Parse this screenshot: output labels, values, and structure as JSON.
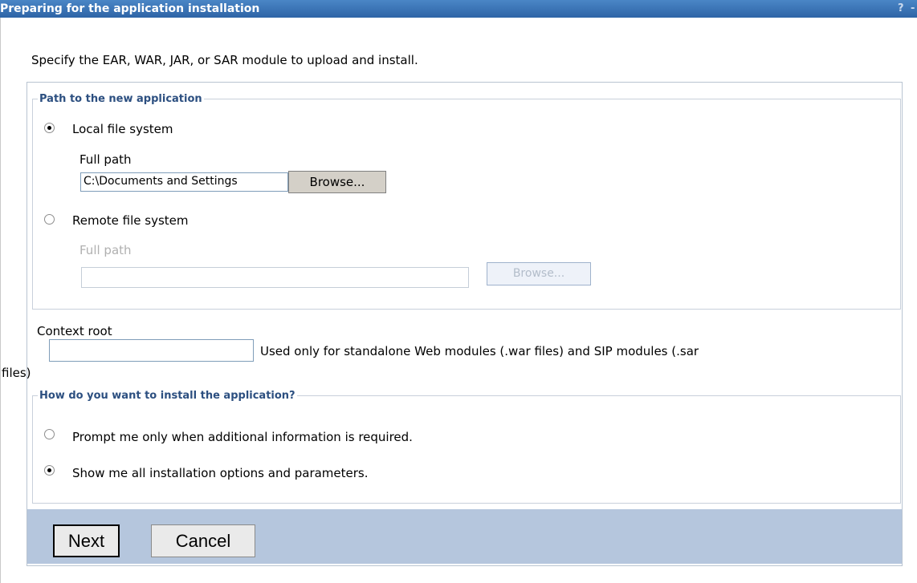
{
  "header": {
    "title": "Preparing for the application installation",
    "help": "?",
    "minimize": "-"
  },
  "instruction": "Specify the EAR, WAR, JAR, or SAR module to upload and install.",
  "path_group": {
    "legend": "Path to the new application",
    "local": {
      "label": "Local file system",
      "selected": true,
      "full_path_label": "Full path",
      "value": "C:\\Documents and Settings",
      "browse": "Browse..."
    },
    "remote": {
      "label": "Remote file system",
      "selected": false,
      "full_path_label": "Full path",
      "value": "",
      "browse": "Browse..."
    }
  },
  "context_root": {
    "label": "Context root",
    "value": "",
    "help_line1": "Used only for standalone Web modules (.war files) and SIP modules (.sar",
    "help_line2": "files)"
  },
  "install_group": {
    "legend": "How do you want to install the application?",
    "options": [
      {
        "label": "Prompt me only when additional information is required.",
        "selected": false
      },
      {
        "label": "Show me all installation options and parameters.",
        "selected": true
      }
    ]
  },
  "footer": {
    "next": "Next",
    "cancel": "Cancel"
  },
  "colors": {
    "titlebar": "#2e64a6",
    "legend_text": "#2c4f80",
    "footer_bg": "#b5c6dd"
  }
}
